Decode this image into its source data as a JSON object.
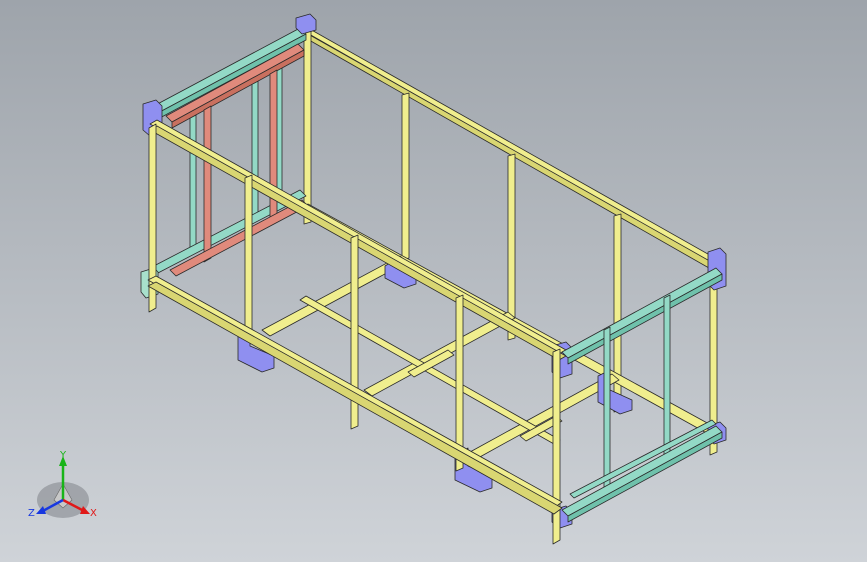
{
  "viewport": {
    "background_top": "#9ea4ab",
    "background_bottom": "#cfd3d8"
  },
  "model": {
    "colors": {
      "yellow_beam": "#f0ee8e",
      "teal_beam": "#93d9c6",
      "red_beam": "#e08a7c",
      "bracket": "#8f8ff0",
      "outline": "#2a2a2a"
    }
  },
  "triad": {
    "y_label": "Y",
    "x_label": "X",
    "z_label": "Z",
    "x_color": "#e01818",
    "y_color": "#18b418",
    "z_color": "#1838e0"
  }
}
